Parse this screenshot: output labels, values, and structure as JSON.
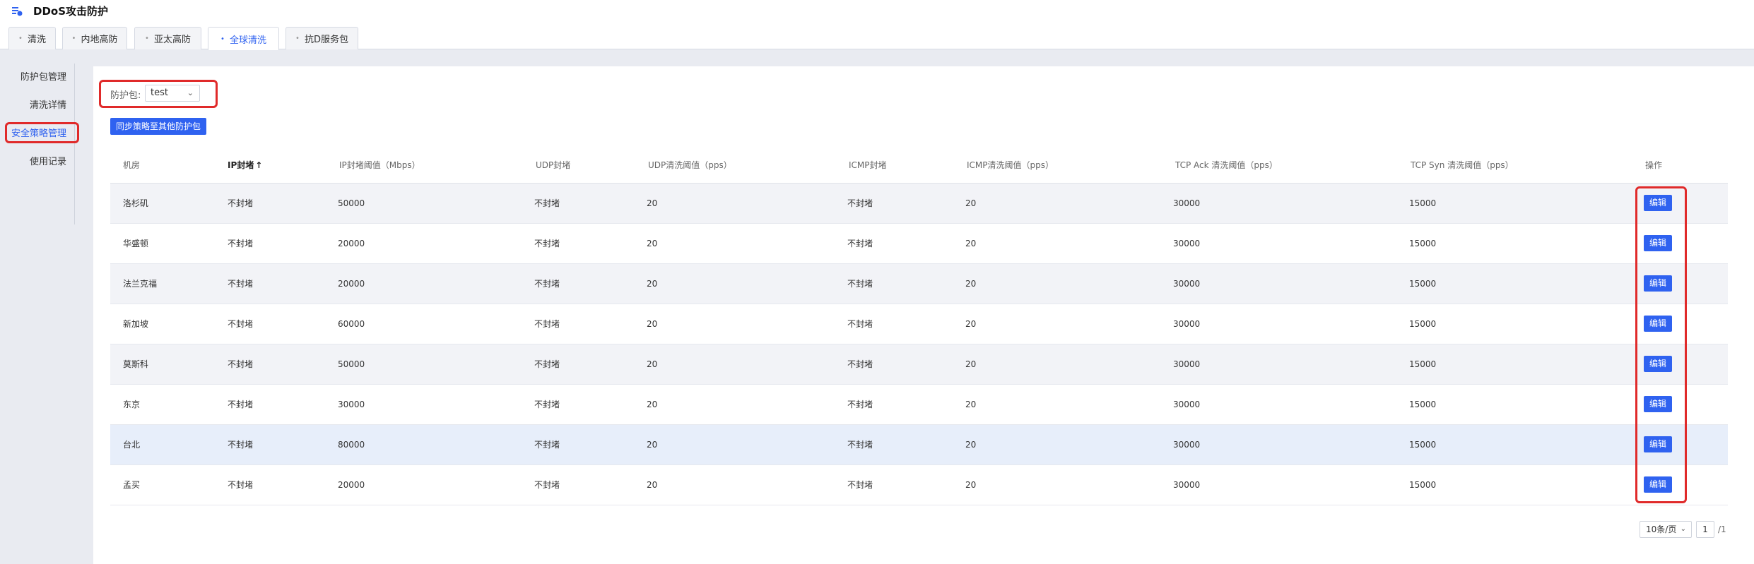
{
  "app": {
    "title": "DDoS攻击防护"
  },
  "tabs": [
    {
      "label": "清洗"
    },
    {
      "label": "内地高防"
    },
    {
      "label": "亚太高防"
    },
    {
      "label": "全球清洗",
      "active": true
    },
    {
      "label": "抗D服务包"
    }
  ],
  "sidebar": {
    "items": [
      {
        "label": "防护包管理"
      },
      {
        "label": "清洗详情"
      },
      {
        "label": "安全策略管理",
        "active": true
      },
      {
        "label": "使用记录"
      }
    ]
  },
  "package": {
    "label": "防护包:",
    "selected": "test"
  },
  "sync_button": "同步策略至其他防护包",
  "table": {
    "columns": [
      "机房",
      "IP封堵",
      "IP封堵阈值（Mbps）",
      "UDP封堵",
      "UDP清洗阈值（pps）",
      "ICMP封堵",
      "ICMP清洗阈值（pps）",
      "TCP Ack 清洗阈值（pps）",
      "TCP Syn 清洗阈值（pps）",
      "操作"
    ],
    "sort_indicator": "↑",
    "rows": [
      [
        "洛杉矶",
        "不封堵",
        "50000",
        "不封堵",
        "20",
        "不封堵",
        "20",
        "30000",
        "15000",
        "编辑"
      ],
      [
        "华盛顿",
        "不封堵",
        "20000",
        "不封堵",
        "20",
        "不封堵",
        "20",
        "30000",
        "15000",
        "编辑"
      ],
      [
        "法兰克福",
        "不封堵",
        "20000",
        "不封堵",
        "20",
        "不封堵",
        "20",
        "30000",
        "15000",
        "编辑"
      ],
      [
        "新加坡",
        "不封堵",
        "60000",
        "不封堵",
        "20",
        "不封堵",
        "20",
        "30000",
        "15000",
        "编辑"
      ],
      [
        "莫斯科",
        "不封堵",
        "50000",
        "不封堵",
        "20",
        "不封堵",
        "20",
        "30000",
        "15000",
        "编辑"
      ],
      [
        "东京",
        "不封堵",
        "30000",
        "不封堵",
        "20",
        "不封堵",
        "20",
        "30000",
        "15000",
        "编辑"
      ],
      [
        "台北",
        "不封堵",
        "80000",
        "不封堵",
        "20",
        "不封堵",
        "20",
        "30000",
        "15000",
        "编辑"
      ],
      [
        "孟买",
        "不封堵",
        "20000",
        "不封堵",
        "20",
        "不封堵",
        "20",
        "30000",
        "15000",
        "编辑"
      ]
    ]
  },
  "pagination": {
    "page_size": "10条/页",
    "page": "1",
    "total": "/1"
  },
  "colors": {
    "accent": "#2f62f0",
    "highlight": "#e02a2a"
  }
}
